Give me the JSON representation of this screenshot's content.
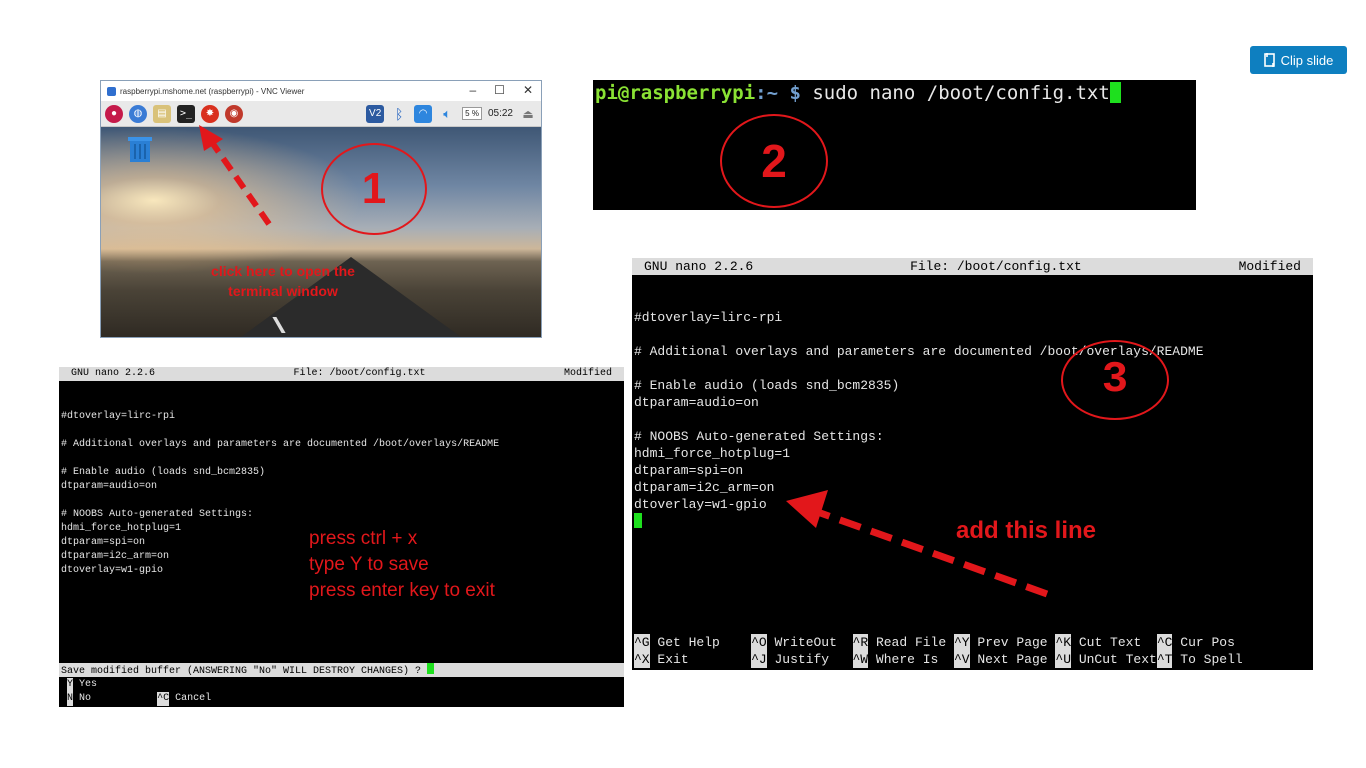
{
  "clip_button": {
    "label": "Clip slide"
  },
  "vnc": {
    "window_title": "raspberrypi.mshome.net (raspberrypi) - VNC Viewer",
    "cpu": "5 %",
    "clock": "05:22",
    "annotation_number": "1",
    "annotation_text": "click here to open the terminal window"
  },
  "terminal": {
    "prompt_user": "pi@raspberrypi",
    "prompt_path": ":~ $",
    "command": " sudo nano /boot/config.txt",
    "annotation_number": "2"
  },
  "nano_editor": {
    "header_left": "GNU nano 2.2.6",
    "header_center": "File: /boot/config.txt",
    "header_right": "Modified",
    "lines": [
      "#dtoverlay=lirc-rpi",
      "",
      "# Additional overlays and parameters are documented /boot/overlays/README",
      "",
      "# Enable audio (loads snd_bcm2835)",
      "dtparam=audio=on",
      "",
      "# NOOBS Auto-generated Settings:",
      "hdmi_force_hotplug=1",
      "dtparam=spi=on",
      "dtparam=i2c_arm=on",
      "dtoverlay=w1-gpio"
    ],
    "annotation_number": "3",
    "annotation_text": "add this line",
    "shortcuts_row1": [
      {
        "key": "^G",
        "label": "Get Help"
      },
      {
        "key": "^O",
        "label": "WriteOut"
      },
      {
        "key": "^R",
        "label": "Read File"
      },
      {
        "key": "^Y",
        "label": "Prev Page"
      },
      {
        "key": "^K",
        "label": "Cut Text"
      },
      {
        "key": "^C",
        "label": "Cur Pos"
      }
    ],
    "shortcuts_row2": [
      {
        "key": "^X",
        "label": "Exit"
      },
      {
        "key": "^J",
        "label": "Justify"
      },
      {
        "key": "^W",
        "label": "Where Is"
      },
      {
        "key": "^V",
        "label": "Next Page"
      },
      {
        "key": "^U",
        "label": "UnCut Text"
      },
      {
        "key": "^T",
        "label": "To Spell"
      }
    ]
  },
  "save_prompt": {
    "question": "Save modified buffer (ANSWERING \"No\" WILL DESTROY CHANGES) ?",
    "yes_key": "Y",
    "yes_label": "Yes",
    "no_key": "N",
    "no_label": "No",
    "cancel_key": "^C",
    "cancel_label": "Cancel",
    "instructions": [
      "press ctrl + x",
      "type Y to save",
      "press enter key to exit"
    ]
  },
  "colors": {
    "annotation_red": "#e2171b",
    "cursor_green": "#1ee01e",
    "clip_blue": "#0e7fc0"
  }
}
